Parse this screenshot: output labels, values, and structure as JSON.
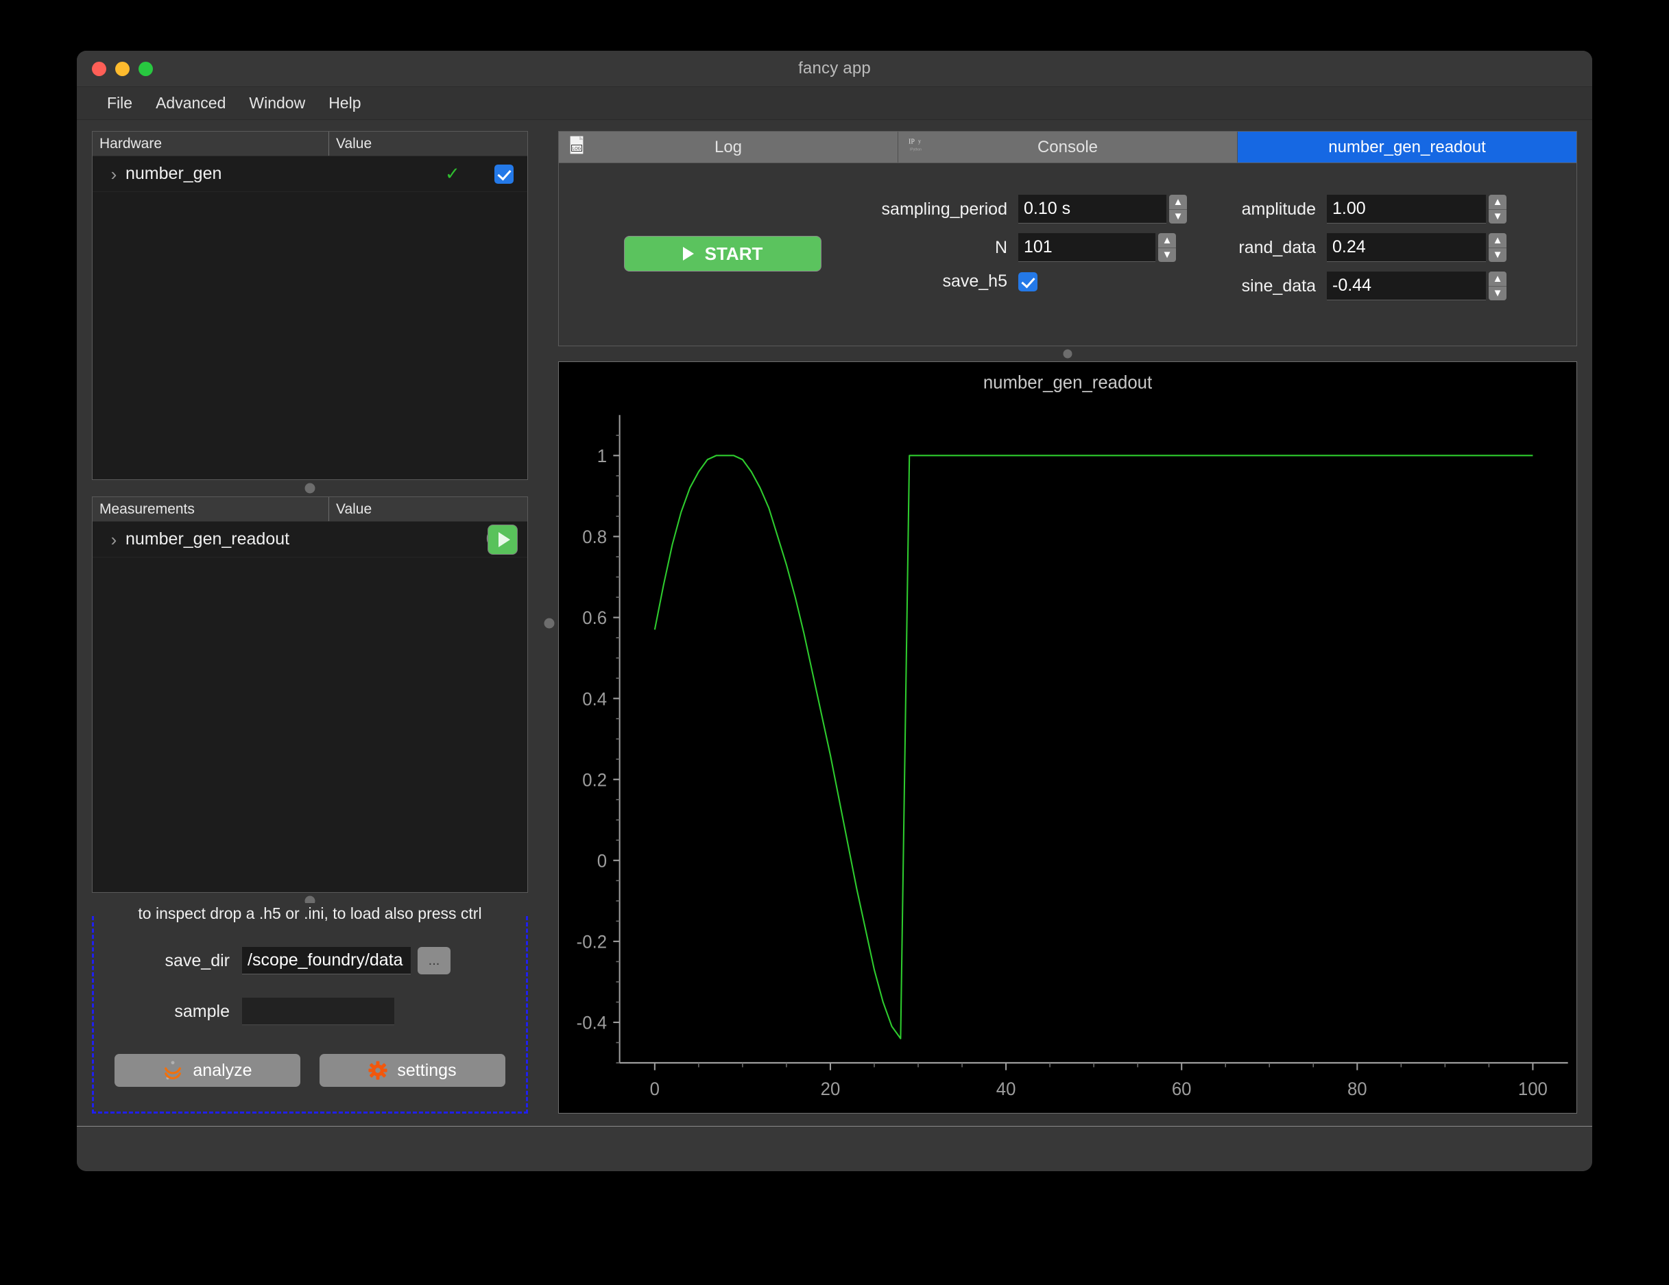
{
  "window": {
    "title": "fancy app",
    "traffic_lights": [
      "close",
      "minimize",
      "maximize"
    ]
  },
  "menu": {
    "items": [
      {
        "label": "File"
      },
      {
        "label": "Advanced"
      },
      {
        "label": "Window"
      },
      {
        "label": "Help"
      }
    ]
  },
  "hardware_tree": {
    "columns": {
      "name": "Hardware",
      "value": "Value"
    },
    "rows": [
      {
        "name": "number_gen",
        "status": "✓",
        "connected": true,
        "expanded": false
      }
    ]
  },
  "measurements_tree": {
    "columns": {
      "name": "Measurements",
      "value": "Value"
    },
    "rows": [
      {
        "name": "number_gen_readout",
        "progress": "0%",
        "expanded": false
      }
    ]
  },
  "drop_zone": {
    "hint": "to inspect drop a .h5 or .ini, to load also press ctrl",
    "save_dir": {
      "label": "save_dir",
      "value": "/scope_foundry/data",
      "browse_label": "..."
    },
    "sample": {
      "label": "sample",
      "value": "",
      "placeholder": ""
    },
    "buttons": [
      {
        "label": "analyze",
        "icon": "jupyter-icon"
      },
      {
        "label": "settings",
        "icon": "gear-icon"
      }
    ]
  },
  "tabs": [
    {
      "label": "Log",
      "icon": "log-document-icon",
      "active": false
    },
    {
      "label": "Console",
      "icon": "ipython-icon",
      "active": false
    },
    {
      "label": "number_gen_readout",
      "icon": null,
      "active": true
    }
  ],
  "settings": {
    "start_button": {
      "label": "START",
      "icon": "play-icon"
    },
    "left_fields": [
      {
        "label": "sampling_period",
        "value": "0.10 s",
        "spinner": true
      },
      {
        "label": "N",
        "value": "101",
        "spinner": true
      }
    ],
    "save_h5": {
      "label": "save_h5",
      "checked": true
    },
    "right_fields": [
      {
        "label": "amplitude",
        "value": "1.00",
        "spinner": true
      },
      {
        "label": "rand_data",
        "value": "0.24",
        "spinner": true
      },
      {
        "label": "sine_data",
        "value": "-0.44",
        "spinner": true
      }
    ]
  },
  "colors": {
    "accent_blue": "#1668e3",
    "start_green": "#5bc35e",
    "trace_green": "#2ecc2e",
    "checkbox_blue": "#2479e8",
    "drop_border_blue": "#1f1ff0",
    "gear_orange": "#f2570c",
    "plot_bg": "#000000"
  },
  "chart_data": {
    "type": "line",
    "title": "number_gen_readout",
    "xlabel": "",
    "ylabel": "",
    "xlim": [
      -4,
      104
    ],
    "ylim": [
      -0.5,
      1.1
    ],
    "xticks": [
      0,
      20,
      40,
      60,
      80,
      100
    ],
    "yticks": [
      1,
      0.8,
      0.6,
      0.4,
      0.2,
      0,
      -0.2,
      -0.4
    ],
    "ytick_labels": [
      "1",
      "0.8",
      "0.6",
      "0.4",
      "0.2",
      "0",
      "-0.2",
      "-0.4"
    ],
    "grid": false,
    "legend": null,
    "line_color": "#2ecc2e",
    "series": [
      {
        "name": "number_gen_readout",
        "comment": "sine sweep: starts 0.57 at x=0, peak 1.0 at x~9, falls to -0.44 at x=28, then holds 1.00 from x=29 to x=100",
        "x": [
          0,
          1,
          2,
          3,
          4,
          5,
          6,
          7,
          8,
          9,
          10,
          11,
          12,
          13,
          14,
          15,
          16,
          17,
          18,
          19,
          20,
          21,
          22,
          23,
          24,
          25,
          26,
          27,
          28,
          29,
          30,
          40,
          50,
          60,
          70,
          80,
          90,
          100
        ],
        "y": [
          0.57,
          0.68,
          0.78,
          0.86,
          0.92,
          0.96,
          0.99,
          1.0,
          1.0,
          1.0,
          0.99,
          0.96,
          0.92,
          0.87,
          0.8,
          0.73,
          0.65,
          0.56,
          0.46,
          0.36,
          0.26,
          0.15,
          0.04,
          -0.07,
          -0.17,
          -0.27,
          -0.35,
          -0.41,
          -0.44,
          1.0,
          1.0,
          1.0,
          1.0,
          1.0,
          1.0,
          1.0,
          1.0,
          1.0
        ]
      }
    ]
  }
}
